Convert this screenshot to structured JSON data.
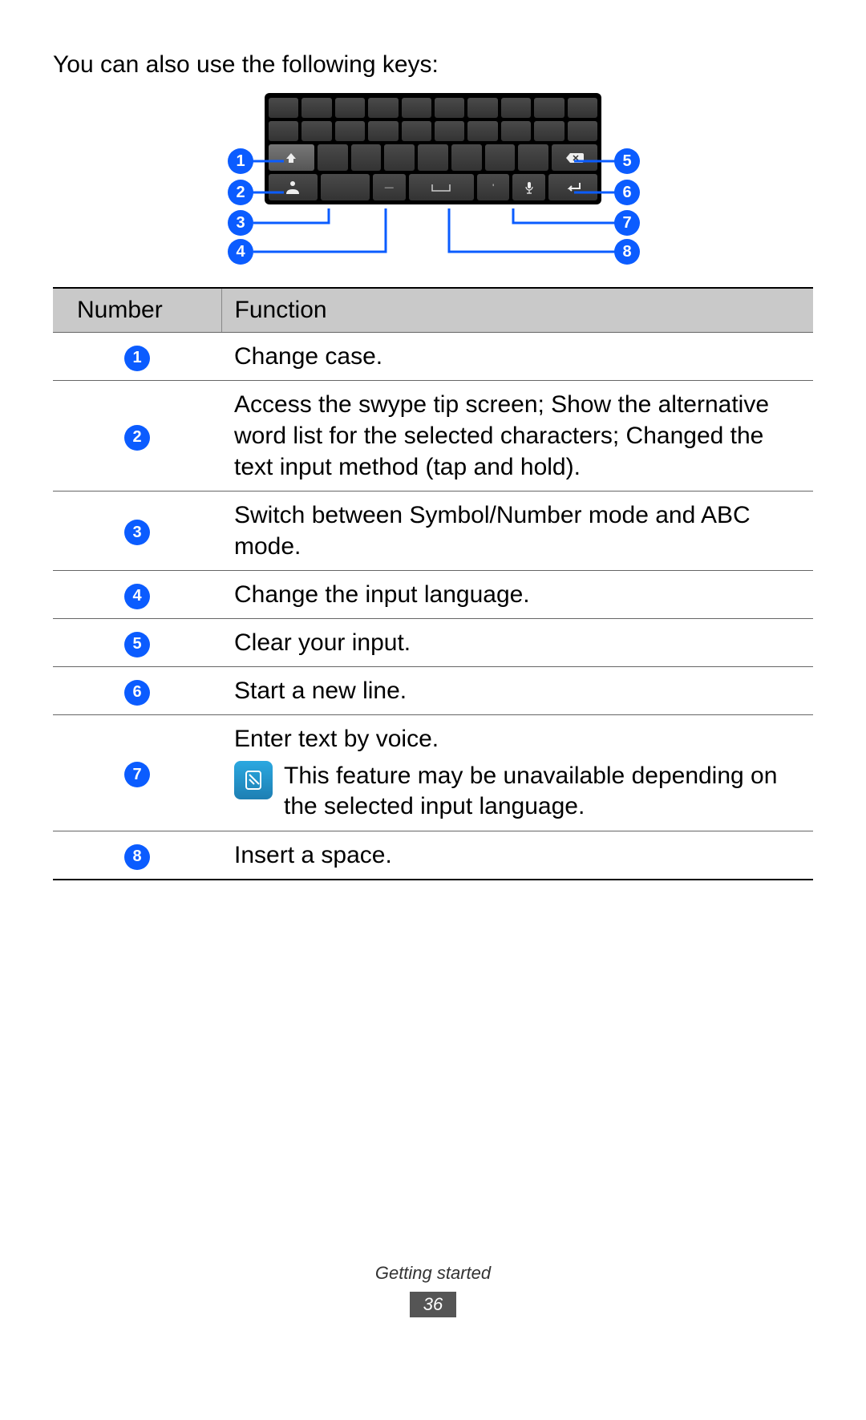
{
  "intro": "You can also use the following keys:",
  "table": {
    "header": {
      "number": "Number",
      "function": "Function"
    },
    "rows": [
      {
        "num": "1",
        "func": "Change case."
      },
      {
        "num": "2",
        "func": "Access the swype tip screen; Show the alternative word list for the selected characters; Changed the text input method (tap and hold)."
      },
      {
        "num": "3",
        "func": "Switch between Symbol/Number mode and ABC mode."
      },
      {
        "num": "4",
        "func": "Change the input language."
      },
      {
        "num": "5",
        "func": "Clear your input."
      },
      {
        "num": "6",
        "func": "Start a new line."
      },
      {
        "num": "7",
        "func": "Enter text by voice.",
        "note": "This feature may be unavailable depending on the selected input language."
      },
      {
        "num": "8",
        "func": "Insert a space."
      }
    ]
  },
  "diagram": {
    "labels": [
      "1",
      "2",
      "3",
      "4",
      "5",
      "6",
      "7",
      "8"
    ]
  },
  "footer": {
    "section": "Getting started",
    "page": "36"
  }
}
